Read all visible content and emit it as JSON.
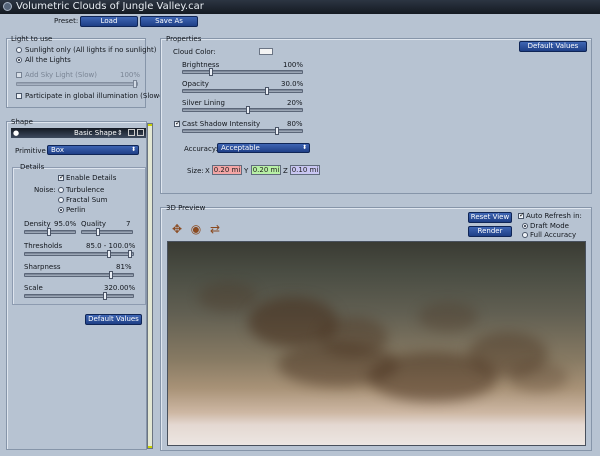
{
  "window": {
    "title": "Volumetric Clouds of Jungle Valley.car"
  },
  "preset": {
    "label": "Preset:",
    "load": "Load",
    "save_as": "Save As"
  },
  "light": {
    "title": "Light to use",
    "sunlight_only": "Sunlight only (All lights if no sunlight)",
    "all_lights": "All the Lights",
    "add_sky_light": "Add Sky Light (Slow)",
    "sky_light_value": "100%",
    "participate": "Participate in global illumination (Slower)"
  },
  "shape": {
    "title": "Shape",
    "layer_name": "Basic Shape",
    "primitive_label": "Primitive :",
    "primitive_value": "Box",
    "details_title": "Details",
    "enable_details": "Enable Details",
    "noise_label": "Noise:",
    "noise_options": [
      "Turbulence",
      "Fractal Sum",
      "Perlin"
    ],
    "density_label": "Density",
    "density_value": "95.0%",
    "quality_label": "Quality",
    "quality_value": "7",
    "thresholds_label": "Thresholds",
    "thresholds_value": "85.0 - 100.0%",
    "sharpness_label": "Sharpness",
    "sharpness_value": "81%",
    "scale_label": "Scale",
    "scale_value": "320.00%",
    "default_values": "Default Values"
  },
  "properties": {
    "title": "Properties",
    "default_values": "Default Values",
    "cloud_color_label": "Cloud Color:",
    "cloud_color": "#f4f4f4",
    "brightness_label": "Brightness",
    "brightness_value": "100%",
    "opacity_label": "Opacity",
    "opacity_value": "30.0%",
    "silver_lining_label": "Silver Lining",
    "silver_lining_value": "20%",
    "cast_shadow_label": "Cast Shadow Intensity",
    "cast_shadow_value": "80%",
    "accuracy_label": "Accuracy:",
    "accuracy_value": "Acceptable",
    "size_label": "Size:",
    "x_label": "X",
    "x_value": "0.20 mi",
    "y_label": "Y",
    "y_value": "0.20 mi",
    "z_label": "Z",
    "z_value": "0.10 mi",
    "x_color": "#f4a6a6",
    "y_color": "#b8f0a6",
    "z_color": "#c9c6f2"
  },
  "preview": {
    "title": "3D Preview",
    "reset_view": "Reset View",
    "render": "Render",
    "auto_refresh": "Auto Refresh in:",
    "draft_mode": "Draft Mode",
    "full_accuracy": "Full Accuracy",
    "nav_icons": [
      "pan-icon",
      "rotate-icon",
      "zoom-icon"
    ]
  }
}
